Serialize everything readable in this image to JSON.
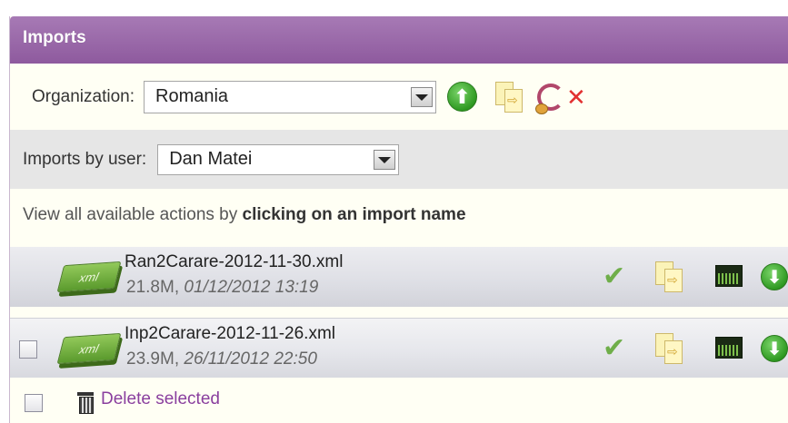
{
  "panel": {
    "title": "Imports"
  },
  "organization": {
    "label": "Organization:",
    "selected": "Romania",
    "icons": [
      "upload-icon",
      "copy-docs-icon",
      "refresh-icon",
      "delete-x-icon"
    ]
  },
  "user_filter": {
    "label": "Imports by user:",
    "selected": "Dan Matei"
  },
  "info": {
    "prefix": "View all available actions by ",
    "bold": "clicking on an import name"
  },
  "imports": [
    {
      "name": "Ran2Carare-2012-11-30.xml",
      "size": "21.8M",
      "sep": ", ",
      "date": "01/12/2012 13:19",
      "has_checkbox": false
    },
    {
      "name": "Inp2Carare-2012-11-26.xml",
      "size": "23.9M",
      "sep": ", ",
      "date": "26/11/2012 22:50",
      "has_checkbox": true
    }
  ],
  "xml_badge": "xml",
  "footer": {
    "delete_label": "Delete selected"
  },
  "colors": {
    "header": "#8e5a9e",
    "link": "#8a3f9e",
    "accent_green": "#2f9a22"
  }
}
